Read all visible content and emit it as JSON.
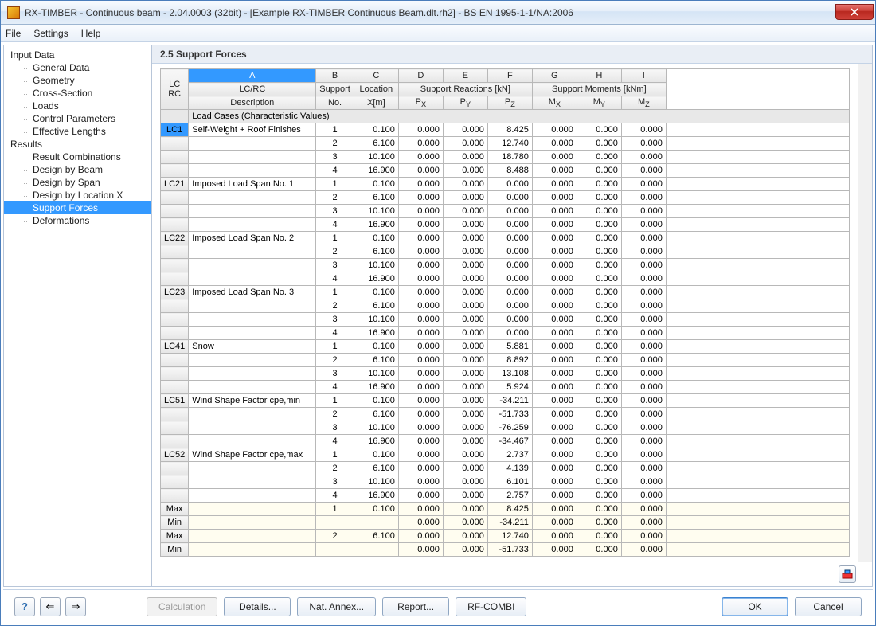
{
  "window": {
    "title": "RX-TIMBER - Continuous beam - 2.04.0003 (32bit) - [Example RX-TIMBER Continuous Beam.dlt.rh2] - BS EN 1995-1-1/NA:2006"
  },
  "menu": {
    "file": "File",
    "settings": "Settings",
    "help": "Help"
  },
  "tree": {
    "input": "Input Data",
    "input_items": [
      "General Data",
      "Geometry",
      "Cross-Section",
      "Loads",
      "Control Parameters",
      "Effective Lengths"
    ],
    "results": "Results",
    "results_items": [
      "Result Combinations",
      "Design by Beam",
      "Design by Span",
      "Design by Location X",
      "Support Forces",
      "Deformations"
    ],
    "selected": "Support Forces"
  },
  "section": {
    "title": "2.5 Support Forces"
  },
  "columns": {
    "letters": [
      "A",
      "B",
      "C",
      "D",
      "E",
      "F",
      "G",
      "H",
      "I"
    ],
    "lcrc": "LC\nRC",
    "lcrc_top": "LC",
    "lcrc_bot": "RC",
    "row1": [
      "LC/RC",
      "Support",
      "Location",
      "Support Reactions [kN]",
      "",
      "",
      "Support Moments [kNm]",
      "",
      ""
    ],
    "row2": [
      "Description",
      "No.",
      "X[m]",
      "Pₓ",
      "Pᵧ",
      "P_Z",
      "Mₓ",
      "Mᵧ",
      "M_Z"
    ],
    "px": "PX",
    "py": "PY",
    "pz": "PZ",
    "mx": "MX",
    "my": "MY",
    "mz": "MZ"
  },
  "group_label": "Load Cases (Characteristic Values)",
  "rows": [
    {
      "lc": "LC1",
      "desc": "Self-Weight + Roof Finishes",
      "sup": "1",
      "x": "0.100",
      "px": "0.000",
      "py": "0.000",
      "pz": "8.425",
      "mx": "0.000",
      "my": "0.000",
      "mz": "0.000"
    },
    {
      "lc": "",
      "desc": "",
      "sup": "2",
      "x": "6.100",
      "px": "0.000",
      "py": "0.000",
      "pz": "12.740",
      "mx": "0.000",
      "my": "0.000",
      "mz": "0.000"
    },
    {
      "lc": "",
      "desc": "",
      "sup": "3",
      "x": "10.100",
      "px": "0.000",
      "py": "0.000",
      "pz": "18.780",
      "mx": "0.000",
      "my": "0.000",
      "mz": "0.000"
    },
    {
      "lc": "",
      "desc": "",
      "sup": "4",
      "x": "16.900",
      "px": "0.000",
      "py": "0.000",
      "pz": "8.488",
      "mx": "0.000",
      "my": "0.000",
      "mz": "0.000"
    },
    {
      "lc": "LC21",
      "desc": "Imposed Load Span No. 1",
      "sup": "1",
      "x": "0.100",
      "px": "0.000",
      "py": "0.000",
      "pz": "0.000",
      "mx": "0.000",
      "my": "0.000",
      "mz": "0.000"
    },
    {
      "lc": "",
      "desc": "",
      "sup": "2",
      "x": "6.100",
      "px": "0.000",
      "py": "0.000",
      "pz": "0.000",
      "mx": "0.000",
      "my": "0.000",
      "mz": "0.000"
    },
    {
      "lc": "",
      "desc": "",
      "sup": "3",
      "x": "10.100",
      "px": "0.000",
      "py": "0.000",
      "pz": "0.000",
      "mx": "0.000",
      "my": "0.000",
      "mz": "0.000"
    },
    {
      "lc": "",
      "desc": "",
      "sup": "4",
      "x": "16.900",
      "px": "0.000",
      "py": "0.000",
      "pz": "0.000",
      "mx": "0.000",
      "my": "0.000",
      "mz": "0.000"
    },
    {
      "lc": "LC22",
      "desc": "Imposed Load Span No. 2",
      "sup": "1",
      "x": "0.100",
      "px": "0.000",
      "py": "0.000",
      "pz": "0.000",
      "mx": "0.000",
      "my": "0.000",
      "mz": "0.000"
    },
    {
      "lc": "",
      "desc": "",
      "sup": "2",
      "x": "6.100",
      "px": "0.000",
      "py": "0.000",
      "pz": "0.000",
      "mx": "0.000",
      "my": "0.000",
      "mz": "0.000"
    },
    {
      "lc": "",
      "desc": "",
      "sup": "3",
      "x": "10.100",
      "px": "0.000",
      "py": "0.000",
      "pz": "0.000",
      "mx": "0.000",
      "my": "0.000",
      "mz": "0.000"
    },
    {
      "lc": "",
      "desc": "",
      "sup": "4",
      "x": "16.900",
      "px": "0.000",
      "py": "0.000",
      "pz": "0.000",
      "mx": "0.000",
      "my": "0.000",
      "mz": "0.000"
    },
    {
      "lc": "LC23",
      "desc": "Imposed Load Span No. 3",
      "sup": "1",
      "x": "0.100",
      "px": "0.000",
      "py": "0.000",
      "pz": "0.000",
      "mx": "0.000",
      "my": "0.000",
      "mz": "0.000"
    },
    {
      "lc": "",
      "desc": "",
      "sup": "2",
      "x": "6.100",
      "px": "0.000",
      "py": "0.000",
      "pz": "0.000",
      "mx": "0.000",
      "my": "0.000",
      "mz": "0.000"
    },
    {
      "lc": "",
      "desc": "",
      "sup": "3",
      "x": "10.100",
      "px": "0.000",
      "py": "0.000",
      "pz": "0.000",
      "mx": "0.000",
      "my": "0.000",
      "mz": "0.000"
    },
    {
      "lc": "",
      "desc": "",
      "sup": "4",
      "x": "16.900",
      "px": "0.000",
      "py": "0.000",
      "pz": "0.000",
      "mx": "0.000",
      "my": "0.000",
      "mz": "0.000"
    },
    {
      "lc": "LC41",
      "desc": "Snow",
      "sup": "1",
      "x": "0.100",
      "px": "0.000",
      "py": "0.000",
      "pz": "5.881",
      "mx": "0.000",
      "my": "0.000",
      "mz": "0.000"
    },
    {
      "lc": "",
      "desc": "",
      "sup": "2",
      "x": "6.100",
      "px": "0.000",
      "py": "0.000",
      "pz": "8.892",
      "mx": "0.000",
      "my": "0.000",
      "mz": "0.000"
    },
    {
      "lc": "",
      "desc": "",
      "sup": "3",
      "x": "10.100",
      "px": "0.000",
      "py": "0.000",
      "pz": "13.108",
      "mx": "0.000",
      "my": "0.000",
      "mz": "0.000"
    },
    {
      "lc": "",
      "desc": "",
      "sup": "4",
      "x": "16.900",
      "px": "0.000",
      "py": "0.000",
      "pz": "5.924",
      "mx": "0.000",
      "my": "0.000",
      "mz": "0.000"
    },
    {
      "lc": "LC51",
      "desc": "Wind Shape Factor cpe,min",
      "sup": "1",
      "x": "0.100",
      "px": "0.000",
      "py": "0.000",
      "pz": "-34.211",
      "mx": "0.000",
      "my": "0.000",
      "mz": "0.000"
    },
    {
      "lc": "",
      "desc": "",
      "sup": "2",
      "x": "6.100",
      "px": "0.000",
      "py": "0.000",
      "pz": "-51.733",
      "mx": "0.000",
      "my": "0.000",
      "mz": "0.000"
    },
    {
      "lc": "",
      "desc": "",
      "sup": "3",
      "x": "10.100",
      "px": "0.000",
      "py": "0.000",
      "pz": "-76.259",
      "mx": "0.000",
      "my": "0.000",
      "mz": "0.000"
    },
    {
      "lc": "",
      "desc": "",
      "sup": "4",
      "x": "16.900",
      "px": "0.000",
      "py": "0.000",
      "pz": "-34.467",
      "mx": "0.000",
      "my": "0.000",
      "mz": "0.000"
    },
    {
      "lc": "LC52",
      "desc": "Wind Shape Factor cpe,max",
      "sup": "1",
      "x": "0.100",
      "px": "0.000",
      "py": "0.000",
      "pz": "2.737",
      "mx": "0.000",
      "my": "0.000",
      "mz": "0.000"
    },
    {
      "lc": "",
      "desc": "",
      "sup": "2",
      "x": "6.100",
      "px": "0.000",
      "py": "0.000",
      "pz": "4.139",
      "mx": "0.000",
      "my": "0.000",
      "mz": "0.000"
    },
    {
      "lc": "",
      "desc": "",
      "sup": "3",
      "x": "10.100",
      "px": "0.000",
      "py": "0.000",
      "pz": "6.101",
      "mx": "0.000",
      "my": "0.000",
      "mz": "0.000"
    },
    {
      "lc": "",
      "desc": "",
      "sup": "4",
      "x": "16.900",
      "px": "0.000",
      "py": "0.000",
      "pz": "2.757",
      "mx": "0.000",
      "my": "0.000",
      "mz": "0.000"
    }
  ],
  "summary_rows": [
    {
      "label": "Max",
      "sup": "1",
      "x": "0.100",
      "px": "0.000",
      "py": "0.000",
      "pz": "8.425",
      "mx": "0.000",
      "my": "0.000",
      "mz": "0.000"
    },
    {
      "label": "Min",
      "sup": "",
      "x": "",
      "px": "0.000",
      "py": "0.000",
      "pz": "-34.211",
      "mx": "0.000",
      "my": "0.000",
      "mz": "0.000"
    },
    {
      "label": "Max",
      "sup": "2",
      "x": "6.100",
      "px": "0.000",
      "py": "0.000",
      "pz": "12.740",
      "mx": "0.000",
      "my": "0.000",
      "mz": "0.000"
    },
    {
      "label": "Min",
      "sup": "",
      "x": "",
      "px": "0.000",
      "py": "0.000",
      "pz": "-51.733",
      "mx": "0.000",
      "my": "0.000",
      "mz": "0.000"
    }
  ],
  "footer": {
    "calculation": "Calculation",
    "details": "Details...",
    "nat_annex": "Nat. Annex...",
    "report": "Report...",
    "rf_combi": "RF-COMBI",
    "ok": "OK",
    "cancel": "Cancel"
  }
}
